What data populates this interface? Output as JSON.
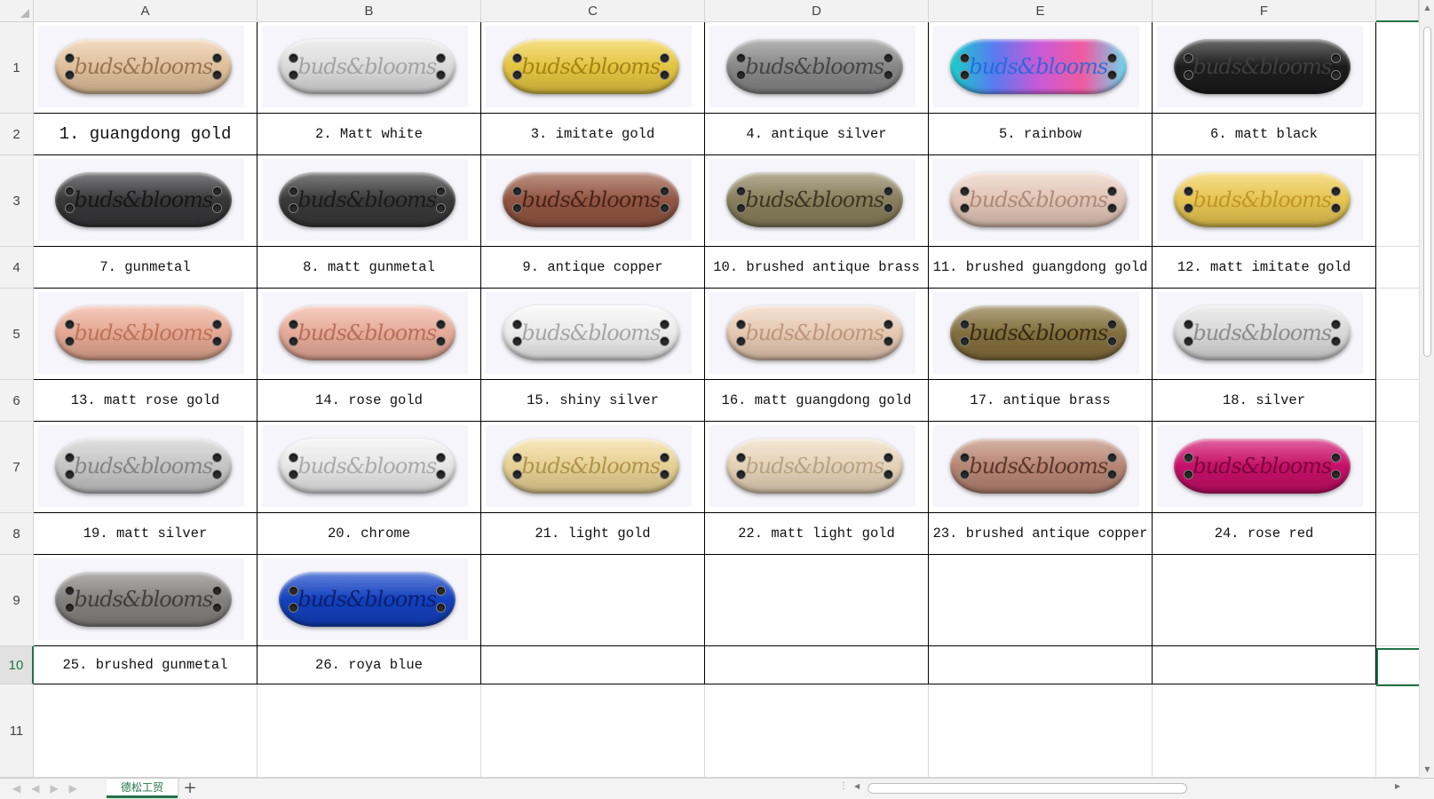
{
  "columns": [
    "A",
    "B",
    "C",
    "D",
    "E",
    "F"
  ],
  "rows": [
    "1",
    "2",
    "3",
    "4",
    "5",
    "6",
    "7",
    "8",
    "9",
    "10",
    "11"
  ],
  "active_row": "10",
  "finishes": [
    {
      "label": "1. guangdong gold",
      "color": "#ecc9a3",
      "text_color": "#8a6a4a"
    },
    {
      "label": "2. Matt white",
      "color": "#e6e6e6",
      "text_color": "#9a9a9a"
    },
    {
      "label": "3. imitate gold",
      "color": "#f0cf45",
      "text_color": "#9a7a10"
    },
    {
      "label": "4. antique silver",
      "color": "#8e8e8e",
      "text_color": "#3a3a3a"
    },
    {
      "label": "5. rainbow",
      "color": "#9a6ff0",
      "text_color": "#1a6ad8"
    },
    {
      "label": "6. matt black",
      "color": "#1e1e1e",
      "text_color": "#444444"
    },
    {
      "label": "7. gunmetal",
      "color": "#3a3a3c",
      "text_color": "#111111"
    },
    {
      "label": "8. matt gunmetal",
      "color": "#3c3c3c",
      "text_color": "#151515"
    },
    {
      "label": "9. antique copper",
      "color": "#9a5a45",
      "text_color": "#3a1a10"
    },
    {
      "label": "10. brushed antique brass",
      "color": "#8f8560",
      "text_color": "#2e2a1a"
    },
    {
      "label": "11. brushed guangdong gold",
      "color": "#edcfc0",
      "text_color": "#a88070"
    },
    {
      "label": "12. matt imitate gold",
      "color": "#f2cf55",
      "text_color": "#b89020"
    },
    {
      "label": "13. matt rose gold",
      "color": "#f0b09a",
      "text_color": "#b86a50"
    },
    {
      "label": "14. rose gold",
      "color": "#f2b3a0",
      "text_color": "#b06550"
    },
    {
      "label": "15. shiny silver",
      "color": "#f7f7f7",
      "text_color": "#9a9a9a"
    },
    {
      "label": "16. matt guangdong gold",
      "color": "#f1d3bc",
      "text_color": "#b88e70"
    },
    {
      "label": "17. antique brass",
      "color": "#8a7440",
      "text_color": "#2b2010"
    },
    {
      "label": "18. silver",
      "color": "#e4e4e4",
      "text_color": "#808080"
    },
    {
      "label": "19. matt silver",
      "color": "#cfcfcf",
      "text_color": "#7a7a7a"
    },
    {
      "label": "20. chrome",
      "color": "#f2f2f2",
      "text_color": "#a0a0a0"
    },
    {
      "label": "21. light gold",
      "color": "#f2db9a",
      "text_color": "#a88a40"
    },
    {
      "label": "22. matt light gold",
      "color": "#f0dcc0",
      "text_color": "#b09a7a"
    },
    {
      "label": "23. brushed antique copper",
      "color": "#c08c7a",
      "text_color": "#4a2a20"
    },
    {
      "label": "24. rose red",
      "color": "#d0106e",
      "text_color": "#6a0030"
    },
    {
      "label": "25. brushed gunmetal",
      "color": "#8a8885",
      "text_color": "#333333"
    },
    {
      "label": "26. roya blue",
      "color": "#1444c8",
      "text_color": "#0a1a60"
    }
  ],
  "plate_text": "buds&blooms",
  "sheet_tab": "德松工贸",
  "add_sheet": "+",
  "accent_color": "#217346"
}
